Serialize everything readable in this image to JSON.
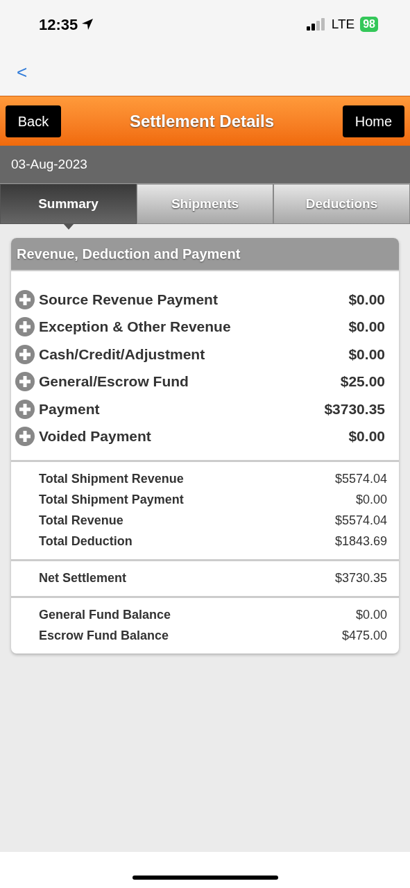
{
  "status_bar": {
    "time": "12:35",
    "network": "LTE",
    "battery": "98"
  },
  "browser_back": "<",
  "header": {
    "back": "Back",
    "title": "Settlement Details",
    "home": "Home"
  },
  "date": "03-Aug-2023",
  "tabs": [
    {
      "label": "Summary",
      "selected": true
    },
    {
      "label": "Shipments",
      "selected": false
    },
    {
      "label": "Deductions",
      "selected": false
    }
  ],
  "card": {
    "title": "Revenue, Deduction and Payment",
    "items": [
      {
        "label": "Source Revenue Payment",
        "amount": "$0.00"
      },
      {
        "label": "Exception & Other Revenue",
        "amount": "$0.00"
      },
      {
        "label": "Cash/Credit/Adjustment",
        "amount": "$0.00"
      },
      {
        "label": "General/Escrow Fund",
        "amount": "$25.00"
      },
      {
        "label": "Payment",
        "amount": "$3730.35"
      },
      {
        "label": "Voided Payment",
        "amount": "$0.00"
      }
    ],
    "groups": [
      [
        {
          "label": "Total Shipment Revenue",
          "value": "$5574.04"
        },
        {
          "label": "Total Shipment Payment",
          "value": "$0.00"
        },
        {
          "label": "Total Revenue",
          "value": "$5574.04"
        },
        {
          "label": "Total Deduction",
          "value": "$1843.69"
        }
      ],
      [
        {
          "label": "Net Settlement",
          "value": "$3730.35"
        }
      ],
      [
        {
          "label": "General Fund Balance",
          "value": "$0.00"
        },
        {
          "label": "Escrow Fund Balance",
          "value": "$475.00"
        }
      ]
    ]
  }
}
